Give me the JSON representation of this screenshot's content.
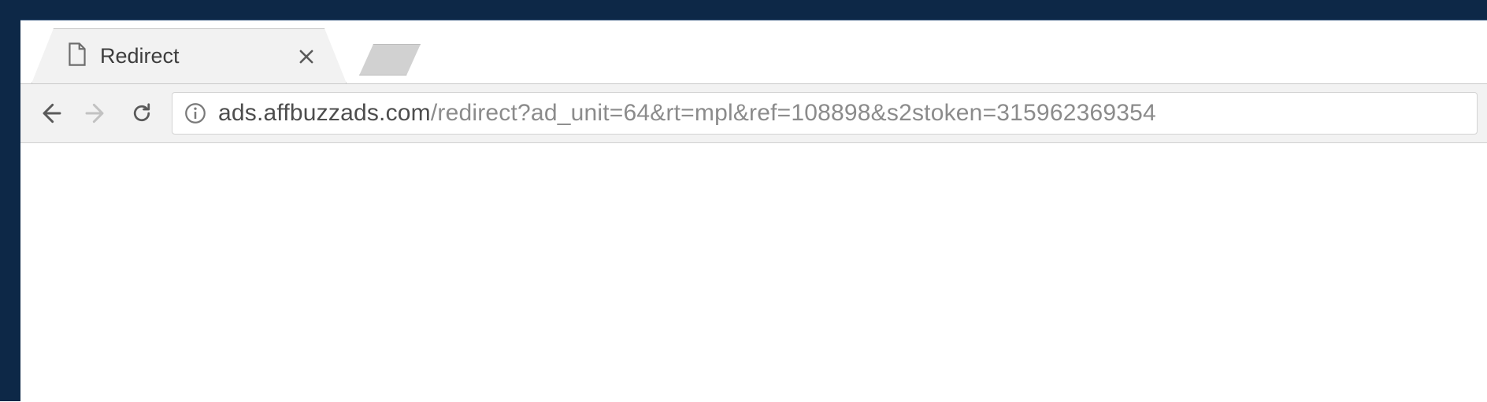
{
  "tabs": [
    {
      "title": "Redirect",
      "favicon": "blank-page-icon"
    }
  ],
  "toolbar": {
    "back_enabled": true,
    "forward_enabled": false,
    "reload_label": "reload"
  },
  "omnibox": {
    "security_state": "info",
    "host": "ads.affbuzzads.com",
    "path": "/redirect?ad_unit=64&rt=mpl&ref=108898&s2stoken=315962369354"
  },
  "colors": {
    "desktop": "#0d2847",
    "chrome_bg": "#f2f2f2",
    "chrome_border": "#c8c8c8",
    "text_primary": "#4d4d4d",
    "text_muted": "#8b8b8b"
  }
}
